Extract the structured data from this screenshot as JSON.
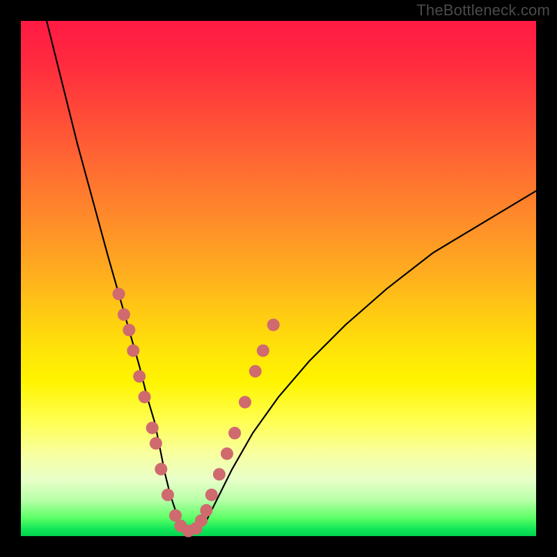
{
  "watermark": "TheBottleneck.com",
  "chart_data": {
    "type": "line",
    "title": "",
    "xlabel": "",
    "ylabel": "",
    "xlim": [
      0,
      100
    ],
    "ylim": [
      0,
      100
    ],
    "grid": false,
    "legend": false,
    "series": [
      {
        "name": "curve",
        "x": [
          5,
          8,
          11,
          14,
          17,
          19,
          21,
          23,
          24.5,
          26,
          27,
          28,
          29,
          30,
          31,
          32.5,
          34,
          36,
          38,
          41,
          45,
          50,
          56,
          63,
          71,
          80,
          90,
          100
        ],
        "y": [
          100,
          88,
          76,
          65,
          54,
          47,
          40,
          33,
          27,
          22,
          17,
          12,
          8,
          5,
          2,
          1,
          1,
          3,
          7,
          13,
          20,
          27,
          34,
          41,
          48,
          55,
          61,
          67
        ]
      }
    ],
    "markers": {
      "name": "highlighted-points",
      "color": "#cf6a6f",
      "points": [
        {
          "x": 19.0,
          "y": 47
        },
        {
          "x": 20.0,
          "y": 43
        },
        {
          "x": 21.0,
          "y": 40
        },
        {
          "x": 21.8,
          "y": 36
        },
        {
          "x": 23.0,
          "y": 31
        },
        {
          "x": 24.0,
          "y": 27
        },
        {
          "x": 25.5,
          "y": 21
        },
        {
          "x": 26.2,
          "y": 18
        },
        {
          "x": 27.2,
          "y": 13
        },
        {
          "x": 28.5,
          "y": 8
        },
        {
          "x": 30.0,
          "y": 4
        },
        {
          "x": 31.0,
          "y": 2
        },
        {
          "x": 32.5,
          "y": 1
        },
        {
          "x": 34.0,
          "y": 1.5
        },
        {
          "x": 35.0,
          "y": 3
        },
        {
          "x": 36.0,
          "y": 5
        },
        {
          "x": 37.0,
          "y": 8
        },
        {
          "x": 38.5,
          "y": 12
        },
        {
          "x": 40.0,
          "y": 16
        },
        {
          "x": 41.5,
          "y": 20
        },
        {
          "x": 43.5,
          "y": 26
        },
        {
          "x": 45.5,
          "y": 32
        },
        {
          "x": 47.0,
          "y": 36
        },
        {
          "x": 49.0,
          "y": 41
        }
      ]
    }
  }
}
